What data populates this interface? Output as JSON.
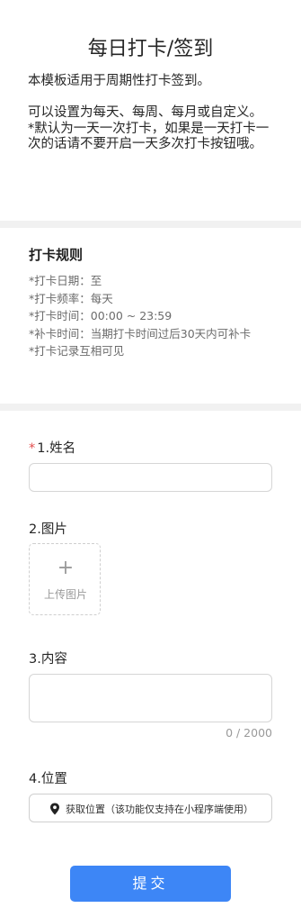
{
  "header": {
    "title": "每日打卡/签到",
    "description": "本模板适用于周期性打卡签到。\n\n可以设置为每天、每周、每月或自定义。\n*默认为一天一次打卡，如果是一天打卡一次的话请不要开启一天多次打卡按钮哦。"
  },
  "rules": {
    "title": "打卡规则",
    "items": [
      "*打卡日期：至",
      "*打卡频率：每天",
      "*打卡时间：00:00 ~ 23:59",
      "*补卡时间：当期打卡时间过后30天内可补卡",
      "*打卡记录互相可见"
    ]
  },
  "form": {
    "name_required_mark": "*",
    "name_label": "1.姓名",
    "name_value": "",
    "image_label": "2.图片",
    "upload_plus": "+",
    "upload_text": "上传图片",
    "content_label": "3.内容",
    "content_value": "",
    "content_counter": "0 / 2000",
    "location_label": "4.位置",
    "location_button": "获取位置（该功能仅支持在小程序端使用）",
    "submit_label": "提交"
  },
  "icons": {
    "location": "map-pin-icon"
  },
  "colors": {
    "primary": "#3d86f6",
    "required": "#e34d4d",
    "divider": "#f1f1f1"
  }
}
